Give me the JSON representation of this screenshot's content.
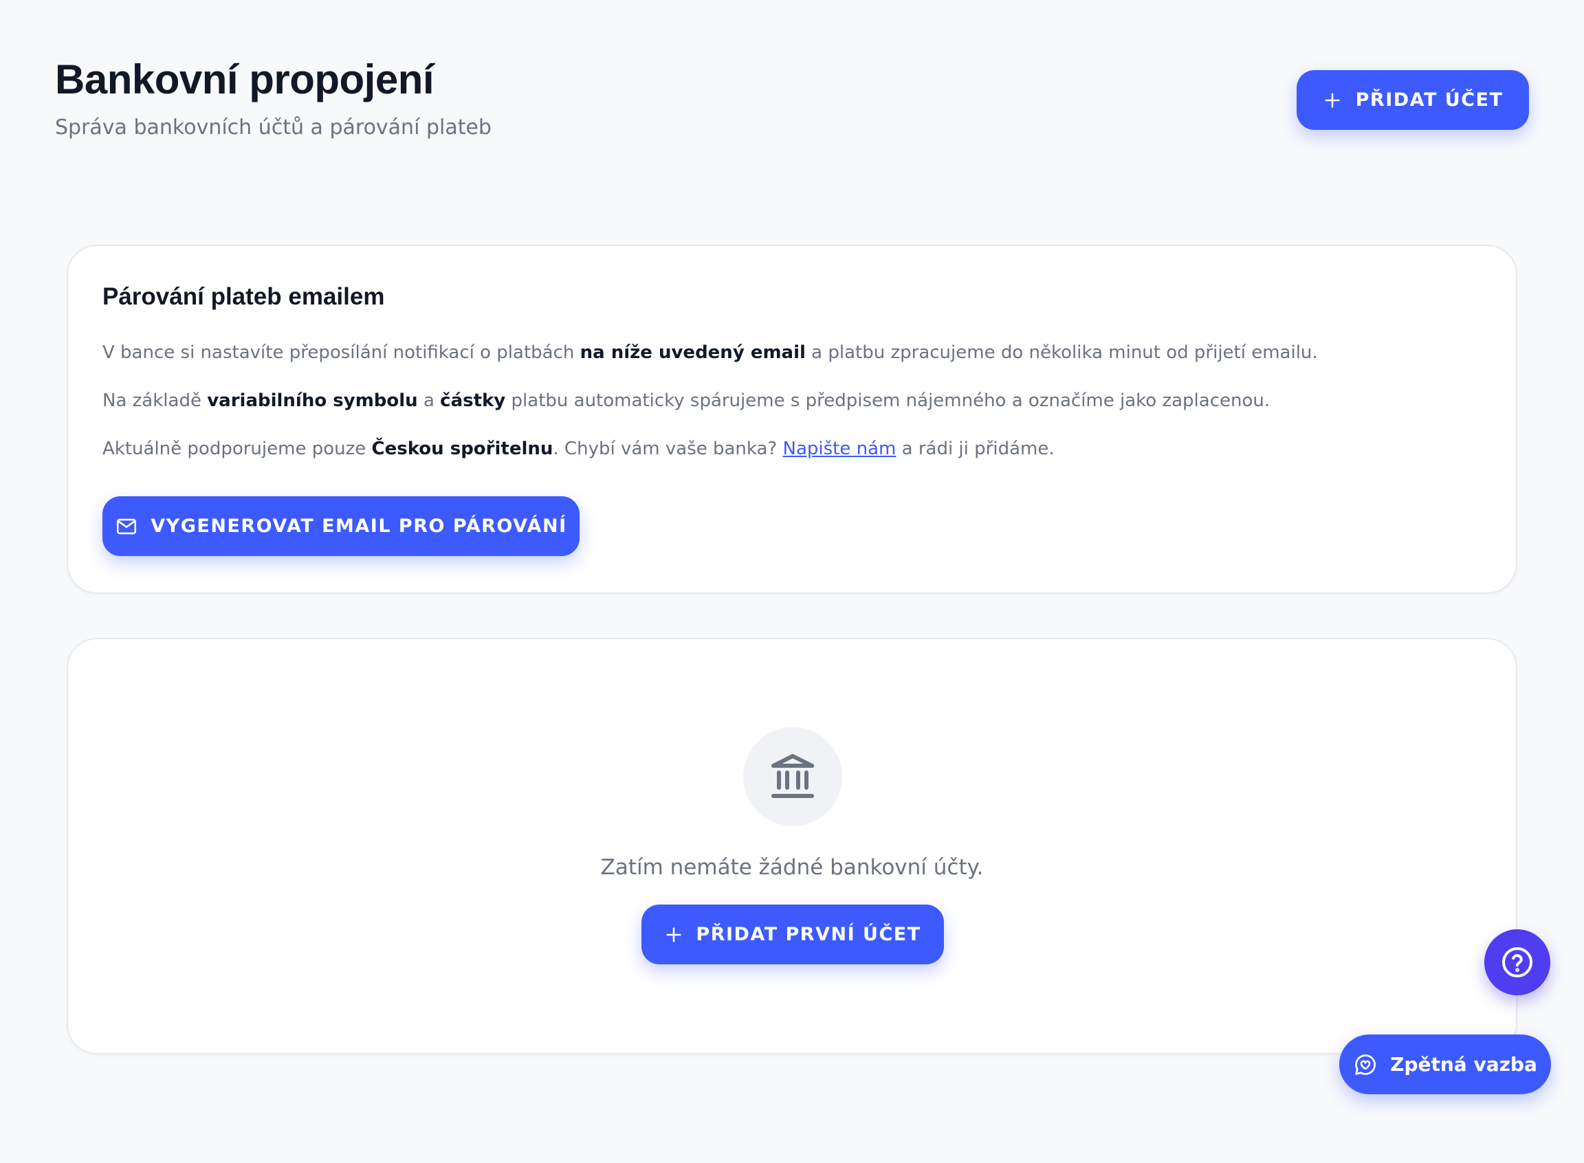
{
  "header": {
    "title": "Bankovní propojení",
    "subtitle": "Správa bankovních účtů a párování plateb",
    "add_account_label": "Přidat účet"
  },
  "email_card": {
    "title": "Párování plateb emailem",
    "para1": {
      "t1": "V bance si nastavíte přeposílání notifikací o platbách ",
      "b1": "na níže uvedený email",
      "t2": " a platbu zpracujeme do několika minut od přijetí emailu."
    },
    "para2": {
      "t1": "Na základě ",
      "b1": "variabilního symbolu",
      "t2": " a ",
      "b2": "částky",
      "t3": " platbu automaticky spárujeme s předpisem nájemného a označíme jako zaplacenou."
    },
    "para3": {
      "t1": "Aktuálně podporujeme pouze ",
      "b1": "Českou spořitelnu",
      "t2": ". Chybí vám vaše banka? ",
      "link": "Napište nám",
      "t3": " a rádi ji přidáme."
    },
    "generate_button_label": "Vygenerovat email pro párování"
  },
  "empty_card": {
    "message": "Zatím nemáte žádné bankovní účty.",
    "add_first_label": "Přidat první účet"
  },
  "feedback": {
    "label": "Zpětná vazba"
  },
  "icons": {
    "plus": "plus-icon",
    "mail": "mail-icon",
    "bank": "bank-icon",
    "help": "help-circle-icon",
    "feedback": "chat-heart-icon"
  },
  "colors": {
    "primary": "#3d5afe",
    "help_fab": "#4f3df0",
    "background": "#f8f9fb",
    "muted_text": "#6b7280"
  }
}
